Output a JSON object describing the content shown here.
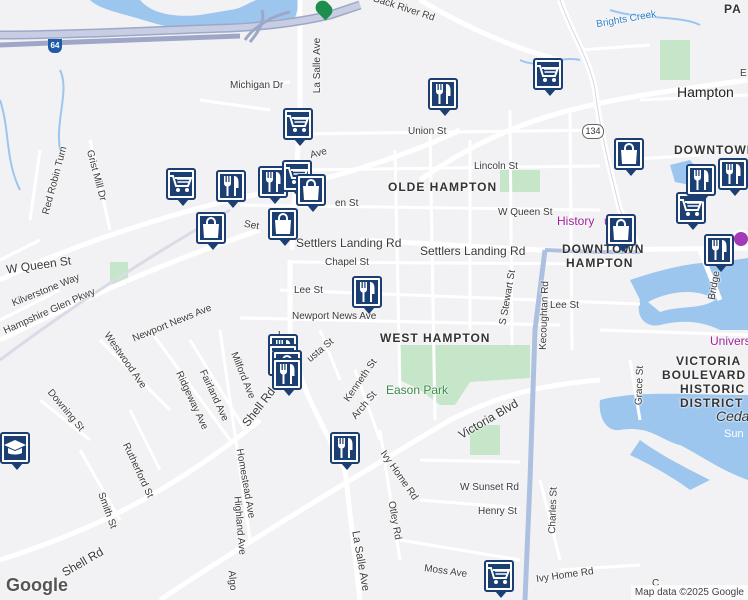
{
  "map": {
    "highway_shield": "64",
    "route_shield": "134",
    "attribution": "Map data ©2025 Google",
    "logo": "Google"
  },
  "streets": [
    {
      "text": "Back River Rd"
    },
    {
      "text": "Brights Creek"
    },
    {
      "text": "Michigan Dr"
    },
    {
      "text": "La Salle Ave"
    },
    {
      "text": "Union St"
    },
    {
      "text": "Lincoln St"
    },
    {
      "text": "Grist Mill Dr"
    },
    {
      "text": "Red Robin Turn"
    },
    {
      "text": "W Queen St"
    },
    {
      "text": "W Queen St"
    },
    {
      "text": "en St"
    },
    {
      "text": "Settlers Landing Rd"
    },
    {
      "text": "Settlers Landing Rd"
    },
    {
      "text": "Chapel St"
    },
    {
      "text": "Lee St"
    },
    {
      "text": "Lee St"
    },
    {
      "text": "Kilverstone Way"
    },
    {
      "text": "Hampshire Glen Pkwy"
    },
    {
      "text": "Newport News Ave"
    },
    {
      "text": "Newport News Ave"
    },
    {
      "text": "Westwood Ave"
    },
    {
      "text": "Fairland Ave"
    },
    {
      "text": "Ridgeway Ave"
    },
    {
      "text": "Milford Ave"
    },
    {
      "text": "Shell Rd"
    },
    {
      "text": "Shell Rd"
    },
    {
      "text": "Homestead Ave"
    },
    {
      "text": "Highland Ave"
    },
    {
      "text": "Downing St"
    },
    {
      "text": "Rutherford St"
    },
    {
      "text": "Smith St"
    },
    {
      "text": "Kenneth St"
    },
    {
      "text": "Arch St"
    },
    {
      "text": "Victoria Blvd"
    },
    {
      "text": "S Stewart St"
    },
    {
      "text": "Kecoughtan Rd"
    },
    {
      "text": "Grace St"
    },
    {
      "text": "Ivy Home Rd"
    },
    {
      "text": "Ivy Home Rd"
    },
    {
      "text": "Otley Rd"
    },
    {
      "text": "W Sunset Rd"
    },
    {
      "text": "Henry St"
    },
    {
      "text": "Charles St"
    },
    {
      "text": "La Salle Ave"
    },
    {
      "text": "Moss Ave"
    },
    {
      "text": "Bridge"
    },
    {
      "text": "usta St"
    },
    {
      "text": "Ave"
    },
    {
      "text": "Algo"
    },
    {
      "text": "L"
    },
    {
      "text": "Set"
    },
    {
      "text": "Be"
    },
    {
      "text": "C"
    },
    {
      "text": "E"
    }
  ],
  "areas": [
    {
      "text": "OLDE HAMPTON"
    },
    {
      "text": "WEST HAMPTON"
    },
    {
      "text": "DOWNTOWN"
    },
    {
      "text": "HAMPTON"
    },
    {
      "text": "DOWNTOWN"
    },
    {
      "text": "VICTORIA"
    },
    {
      "text": "BOULEVARD"
    },
    {
      "text": "HISTORIC"
    },
    {
      "text": "DISTRICT"
    },
    {
      "text": "PA"
    }
  ],
  "cities": [
    {
      "text": "Hampton"
    }
  ],
  "parks": [
    {
      "text": "Eason Park"
    }
  ],
  "waters": [
    {
      "text": "Ceda"
    },
    {
      "text": "Sun"
    }
  ],
  "pois": [
    {
      "text": "History"
    },
    {
      "text": "um"
    },
    {
      "text": "Univers"
    }
  ],
  "markers": [
    {
      "icon": "restaurant-icon"
    },
    {
      "icon": "grocery-cart-icon"
    },
    {
      "icon": "grocery-cart-icon"
    },
    {
      "icon": "shopping-bag-icon"
    },
    {
      "icon": "grocery-cart-icon"
    },
    {
      "icon": "restaurant-icon"
    },
    {
      "icon": "restaurant-icon"
    },
    {
      "icon": "grocery-cart-icon"
    },
    {
      "icon": "shopping-bag-icon"
    },
    {
      "icon": "shopping-bag-icon"
    },
    {
      "icon": "shopping-bag-icon"
    },
    {
      "icon": "shopping-bag-icon"
    },
    {
      "icon": "restaurant-icon"
    },
    {
      "icon": "restaurant-icon"
    },
    {
      "icon": "grocery-cart-icon"
    },
    {
      "icon": "shopping-bag-icon"
    },
    {
      "icon": "restaurant-icon"
    },
    {
      "icon": "restaurant-icon"
    },
    {
      "icon": "grocery-cart-icon"
    },
    {
      "icon": "restaurant-icon"
    },
    {
      "icon": "restaurant-icon"
    },
    {
      "icon": "restaurant-icon"
    },
    {
      "icon": "grocery-cart-icon"
    },
    {
      "icon": "graduation-cap-icon"
    }
  ]
}
